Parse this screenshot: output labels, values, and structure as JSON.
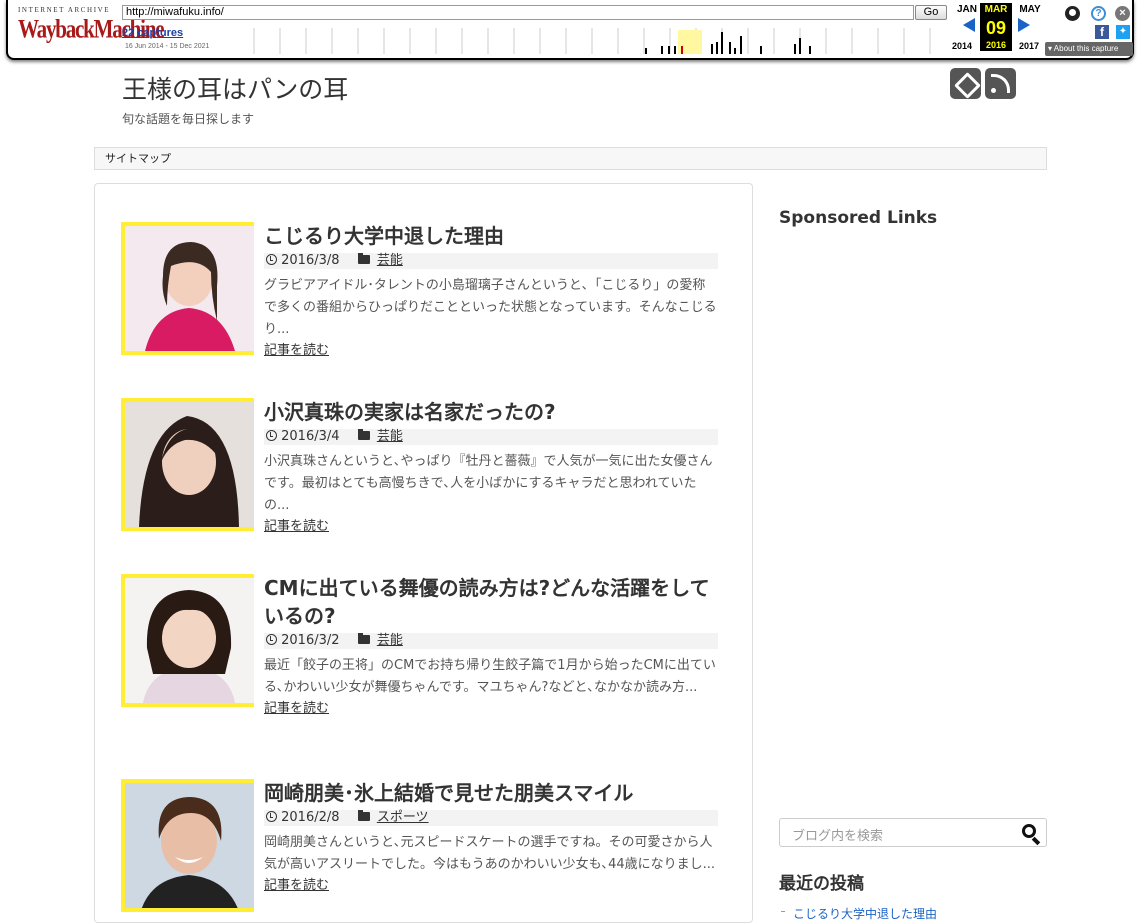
{
  "wayback": {
    "logo_top": "INTERNET ARCHIVE",
    "logo_main": "WaybackMachine",
    "url": "http://miwafuku.info/",
    "go_label": "Go",
    "captures": "22 captures",
    "range": "16 Jun 2014 - 15 Dec 2021",
    "prev_month": "JAN",
    "current_month": "MAR",
    "current_day": "09",
    "next_month": "MAY",
    "prev_year": "2014",
    "current_year": "2016",
    "next_year": "2017",
    "about": "About this capture",
    "icons": [
      "user-icon",
      "help-icon",
      "close-icon",
      "facebook-icon",
      "twitter-icon"
    ]
  },
  "site": {
    "title": "王様の耳はパンの耳",
    "description": "旬な話題を毎日探します",
    "nav_item": "サイトマップ"
  },
  "posts": [
    {
      "title": "こじるり大学中退した理由",
      "date": "2016/3/8",
      "category": "芸能",
      "excerpt": "グラビアアイドル･タレントの小島瑠璃子さんというと､「こじるり」の愛称で多くの番組からひっぱりだことといった状態となっています。そんなこじるり...",
      "more": "記事を読む"
    },
    {
      "title": "小沢真珠の実家は名家だったの?",
      "date": "2016/3/4",
      "category": "芸能",
      "excerpt": "小沢真珠さんというと､やっぱり『牡丹と薔薇』で人気が一気に出た女優さんです。最初はとても高慢ちきで､人を小ばかにするキャラだと思われていたの...",
      "more": "記事を読む"
    },
    {
      "title": "CMに出ている舞優の読み方は?どんな活躍をしているの?",
      "date": "2016/3/2",
      "category": "芸能",
      "excerpt": "最近「餃子の王将」のCMでお持ち帰り生餃子篇で1月から始ったCMに出ている､かわいい少女が舞優ちゃんです。マユちゃん?などと､なかなか読み方...",
      "more": "記事を読む"
    },
    {
      "title": "岡崎朋美･氷上結婚で見せた朋美スマイル",
      "date": "2016/2/8",
      "category": "スポーツ",
      "excerpt": "岡崎朋美さんというと､元スピードスケートの選手ですね。その可愛さから人気が高いアスリートでした。今はもうあのかわいい少女も､44歳になりまし...",
      "more": "記事を読む"
    }
  ],
  "sidebar": {
    "sponsored": "Sponsored Links",
    "search_placeholder": "ブログ内を検索",
    "recent_title": "最近の投稿",
    "recent_first": "こじるり大学中退した理由"
  },
  "colors": {
    "thumb_border": "#ffee33",
    "wayback_red": "#a81a1a",
    "link_blue": "#1a63c6"
  }
}
